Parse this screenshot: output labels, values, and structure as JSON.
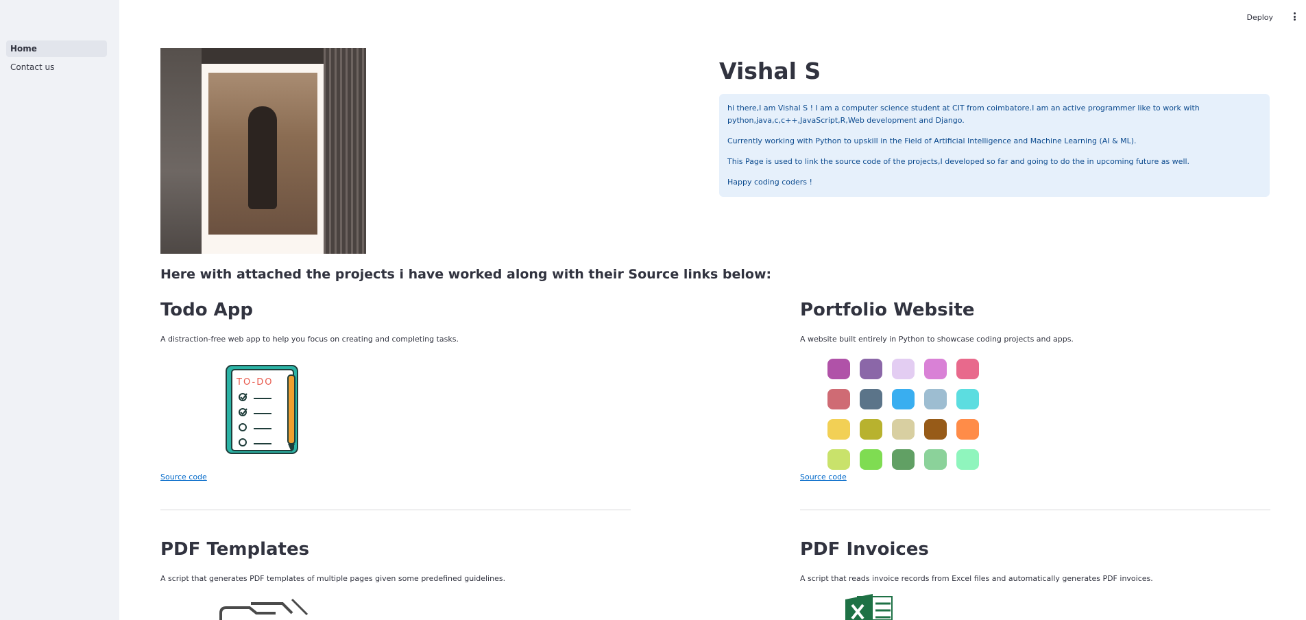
{
  "sidebar": {
    "items": [
      {
        "label": "Home",
        "active": true
      },
      {
        "label": "Contact us",
        "active": false
      }
    ]
  },
  "header": {
    "deploy_label": "Deploy",
    "menu_icon": "kebab-menu-icon"
  },
  "profile": {
    "name": "Vishal S",
    "info": [
      "hi there,I am Vishal S ! I am a computer science student at CIT from coimbatore.I am an active programmer like to work with python,java,c,c++,JavaScript,R,Web development and Django.",
      "Currently working with Python to upskill in the Field of Artificial Intelligence and Machine Learning (AI & ML).",
      "This Page is used to link the source code of the projects,I developed so far and going to do the in upcoming future as well.",
      "Happy coding coders !"
    ]
  },
  "projects_heading": "Here with attached the projects i have worked along with their Source links below:",
  "projects": [
    {
      "title": "Todo App",
      "description": "A distraction-free web app to help you focus on creating and completing tasks.",
      "link_label": "Source code",
      "image_icon": "todo-list-icon",
      "image_text": "TO-DO"
    },
    {
      "title": "Portfolio Website",
      "description": "A website built entirely in Python to showcase coding projects and apps.",
      "link_label": "Source code",
      "image_icon": "color-palette-icon"
    },
    {
      "title": "PDF Templates",
      "description": "A script that generates PDF templates of multiple pages given some predefined guidelines.",
      "image_icon": "pdf-document-icon"
    },
    {
      "title": "PDF Invoices",
      "description": "A script that reads invoice records from Excel files and automatically generates PDF invoices.",
      "image_icon": "excel-icon"
    }
  ],
  "colors": {
    "sidebar_bg": "#f0f2f6",
    "info_bg": "#e6f0fb",
    "info_text": "#0b4a8e",
    "link": "#0068c9",
    "swatches": [
      "#b052a8",
      "#8b67a8",
      "#e3cdf2",
      "#d981d6",
      "#e8698c",
      "#cf6b74",
      "#5b7489",
      "#39aef0",
      "#9dbdd1",
      "#5cdde0",
      "#f2d055",
      "#b8b22e",
      "#d8cfa1",
      "#975b18",
      "#ff8c48",
      "#c9e26b",
      "#7fdc52",
      "#61a064",
      "#8bd29a",
      "#8ff5bd"
    ]
  }
}
